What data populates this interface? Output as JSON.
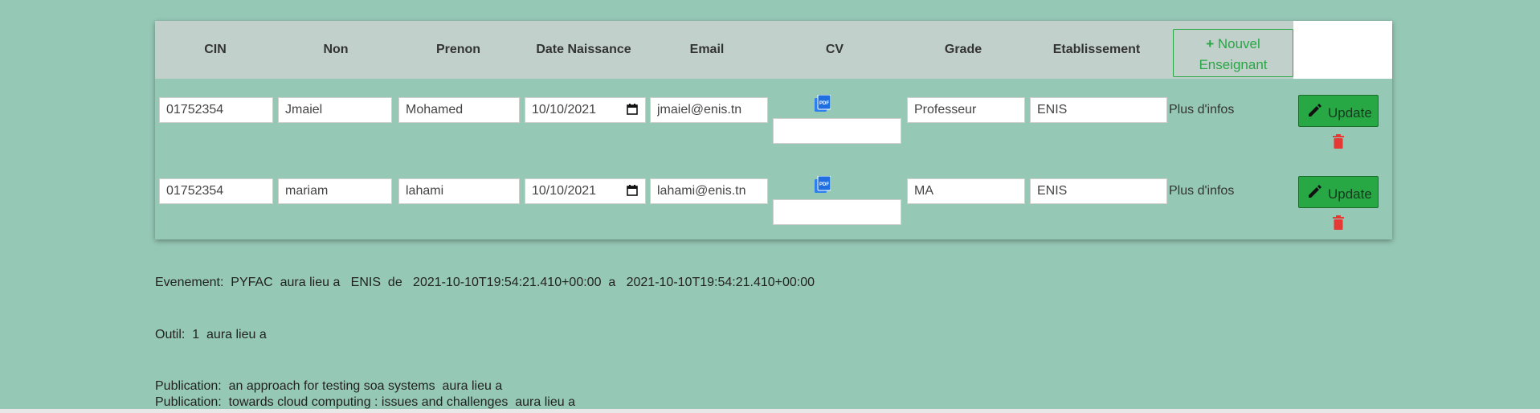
{
  "table": {
    "headers": {
      "cin": "CIN",
      "nom": "Non",
      "prenom": "Prenon",
      "date": "Date Naissance",
      "email": "Email",
      "cv": "CV",
      "grade": "Grade",
      "etablissement": "Etablissement"
    },
    "new_button": {
      "plus": "+",
      "line1": "Nouvel",
      "line2": "Enseignant"
    },
    "rows": [
      {
        "cin": "01752354",
        "nom": "Jmaiel",
        "prenom": "Mohamed",
        "date": "10/10/2021",
        "email": "jmaiel@enis.tn",
        "grade": "Professeur",
        "etablissement": "ENIS",
        "info": "Plus d'infos",
        "update": "Update"
      },
      {
        "cin": "01752354",
        "nom": "mariam",
        "prenom": "lahami",
        "date": "10/10/2021",
        "email": "lahami@enis.tn",
        "grade": "MA",
        "etablissement": "ENIS",
        "info": "Plus d'infos",
        "update": "Update"
      }
    ]
  },
  "icons": {
    "pdf": "pdf-icon",
    "calendar": "calendar-icon",
    "edit": "pencil-icon",
    "delete": "trash-icon"
  },
  "colors": {
    "background": "#96c8b6",
    "header": "#c1d0cb",
    "accent_green": "#28a745",
    "danger_red": "#e53935",
    "pdf_blue": "#2f80ed"
  },
  "lines": {
    "evenement": "Evenement:  PYFAC  aura lieu a   ENIS  de   2021-10-10T19:54:21.410+00:00  a   2021-10-10T19:54:21.410+00:00",
    "outil": "Outil:  1  aura lieu a",
    "publication1": "Publication:  an approach for testing soa systems  aura lieu a",
    "publication2": "Publication:  towards cloud computing : issues and challenges  aura lieu a"
  }
}
